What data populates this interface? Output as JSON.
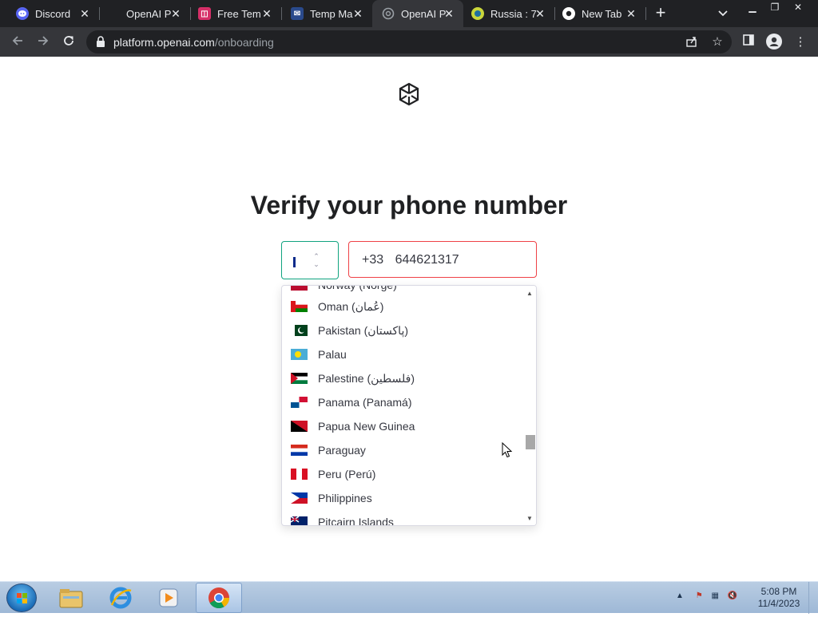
{
  "browser": {
    "tabs": [
      {
        "title": "Discord",
        "active": false,
        "favicon": "discord-icon",
        "color": "#5865f2"
      },
      {
        "title": "OpenAI P",
        "active": false,
        "favicon": "openai-icon",
        "color": "#202124"
      },
      {
        "title": "Free Tem",
        "active": false,
        "favicon": "free-temp-icon",
        "color": "#d62f68"
      },
      {
        "title": "Temp Ma",
        "active": false,
        "favicon": "temp-mail-icon",
        "color": "#2a4a8c"
      },
      {
        "title": "OpenAI P",
        "active": true,
        "favicon": "openai-icon",
        "color": "#35363a"
      },
      {
        "title": "Russia : 7",
        "active": false,
        "favicon": "russia-icon",
        "color": "#c9d63b"
      },
      {
        "title": "New Tab",
        "active": false,
        "favicon": "chrome-icon",
        "color": "#ffffff"
      }
    ],
    "url_host": "platform.openai.com",
    "url_path": "/onboarding"
  },
  "page": {
    "heading": "Verify your phone number",
    "selected_country": "France",
    "dial_code": "+33",
    "phone_value": "644621317"
  },
  "dropdown": {
    "options": [
      {
        "label": "Norway (Norge)",
        "flag": "norway"
      },
      {
        "label": "Oman (عُمان)",
        "flag": "oman"
      },
      {
        "label": "Pakistan (پاکستان)",
        "flag": "pakistan"
      },
      {
        "label": "Palau",
        "flag": "palau"
      },
      {
        "label": "Palestine (فلسطين)",
        "flag": "palestine"
      },
      {
        "label": "Panama (Panamá)",
        "flag": "panama"
      },
      {
        "label": "Papua New Guinea",
        "flag": "papua-new-guinea"
      },
      {
        "label": "Paraguay",
        "flag": "paraguay"
      },
      {
        "label": "Peru (Perú)",
        "flag": "peru"
      },
      {
        "label": "Philippines",
        "flag": "philippines"
      },
      {
        "label": "Pitcairn Islands",
        "flag": "pitcairn-islands"
      }
    ]
  },
  "taskbar": {
    "time": "5:08 PM",
    "date": "11/4/2023"
  }
}
